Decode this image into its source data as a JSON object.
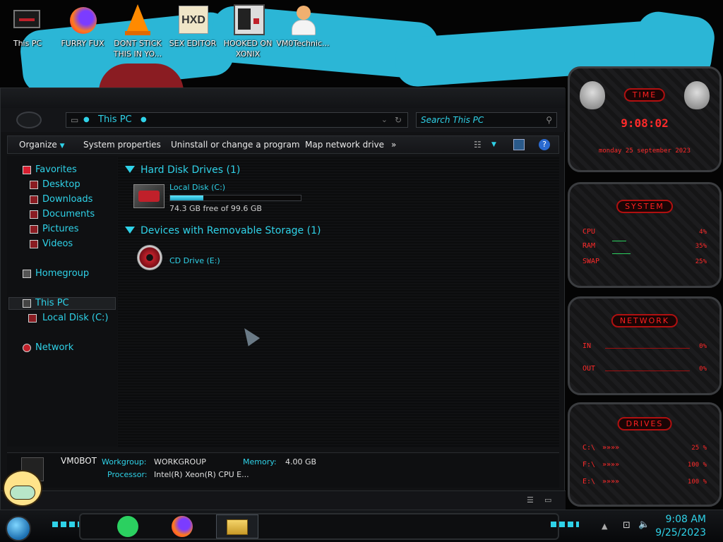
{
  "desktop": {
    "icons": [
      {
        "label": "This PC"
      },
      {
        "label": "FURRY FUX"
      },
      {
        "label": "DONT STICK THIS IN YO..."
      },
      {
        "label": "SEX EDITOR"
      },
      {
        "label": "HOOKED ON XONIX"
      },
      {
        "label": "VM0Technic..."
      }
    ]
  },
  "explorer": {
    "address": "This PC",
    "search_placeholder": "Search This PC",
    "toolbar": {
      "organize": "Organize",
      "system_properties": "System properties",
      "uninstall": "Uninstall or change a program",
      "map_drive": "Map network drive",
      "more": "»"
    },
    "sidebar": {
      "favorites": "Favorites",
      "desktop": "Desktop",
      "downloads": "Downloads",
      "documents": "Documents",
      "pictures": "Pictures",
      "videos": "Videos",
      "homegroup": "Homegroup",
      "this_pc": "This PC",
      "local_disk": "Local Disk (C:)",
      "network": "Network"
    },
    "groups": {
      "hdd_header": "Hard Disk Drives (1)",
      "removable_header": "Devices with Removable Storage (1)"
    },
    "drives": {
      "c_name": "Local Disk (C:)",
      "c_free": "74.3 GB free of 99.6 GB",
      "c_used_fraction": 0.254,
      "e_name": "CD Drive (E:)"
    },
    "details": {
      "computer_name": "VM0BOT",
      "workgroup_label": "Workgroup:",
      "workgroup_value": "WORKGROUP",
      "memory_label": "Memory:",
      "memory_value": "4.00 GB",
      "processor_label": "Processor:",
      "processor_value": "Intel(R) Xeon(R) CPU E..."
    }
  },
  "gadgets": {
    "time": {
      "header": "TIME",
      "clock": "9:08:02",
      "date": "monday 25 september 2023"
    },
    "system": {
      "header": "SYSTEM",
      "rows": [
        {
          "name": "CPU",
          "value": "4%"
        },
        {
          "name": "RAM",
          "value": "35%"
        },
        {
          "name": "SWAP",
          "value": "25%"
        }
      ]
    },
    "network": {
      "header": "NETWORK",
      "rows": [
        {
          "name": "IN",
          "value": "0%"
        },
        {
          "name": "OUT",
          "value": "0%"
        }
      ]
    },
    "drives": {
      "header": "DRIVES",
      "rows": [
        {
          "name": "C:\\",
          "value": "25 %"
        },
        {
          "name": "F:\\",
          "value": "100 %"
        },
        {
          "name": "E:\\",
          "value": "100 %"
        }
      ]
    }
  },
  "taskbar": {
    "time": "9:08 AM",
    "date": "9/25/2023"
  }
}
